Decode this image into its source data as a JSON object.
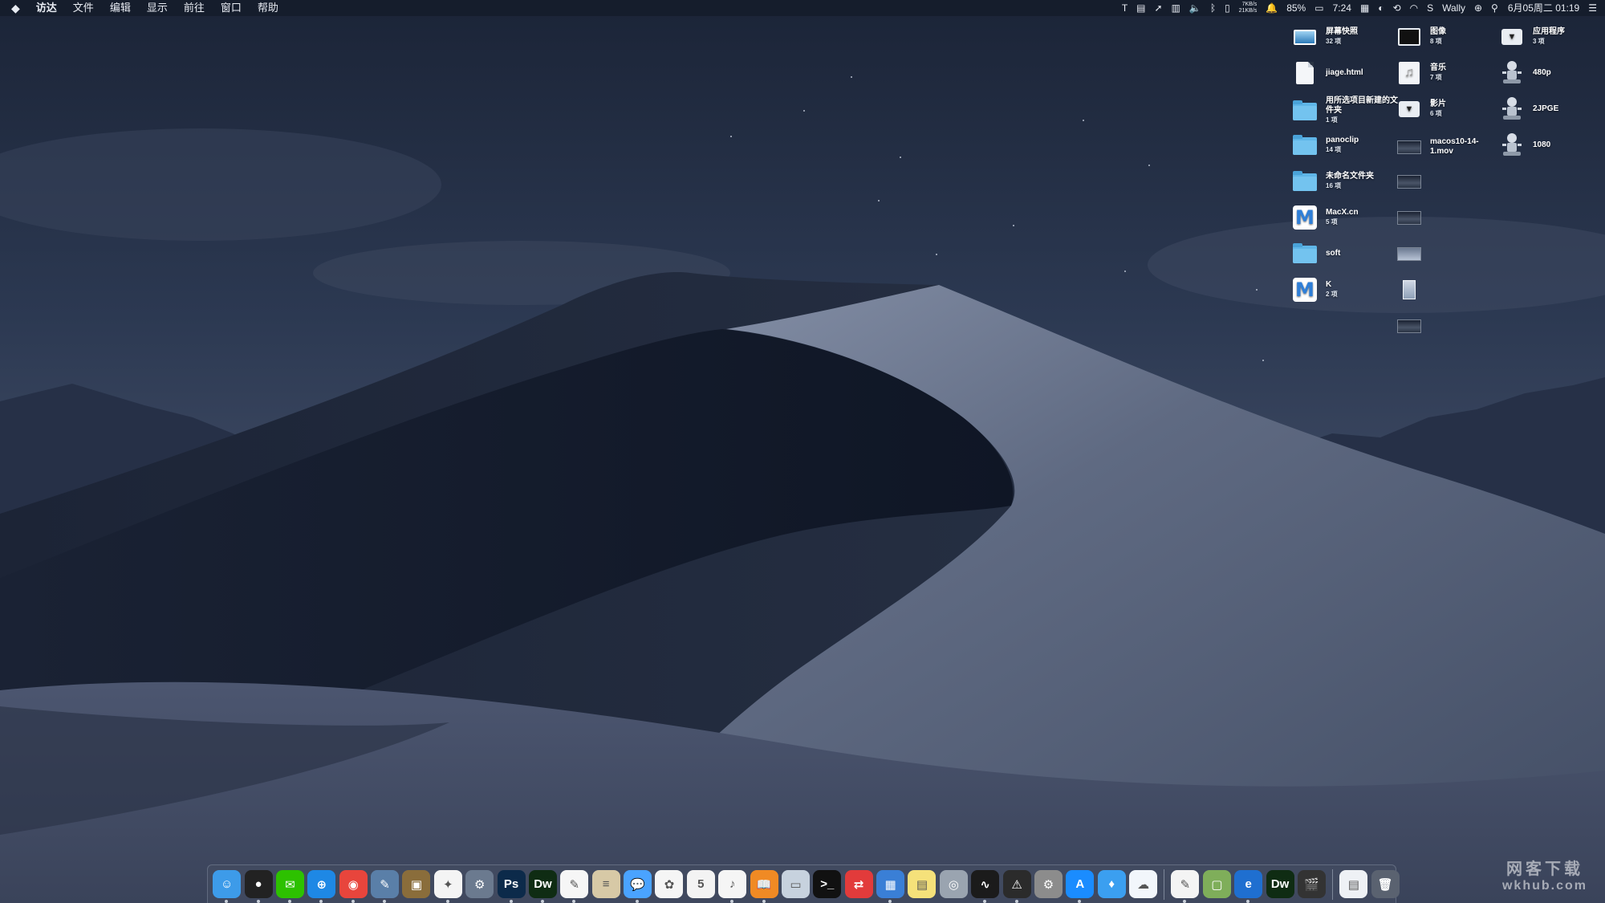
{
  "menubar": {
    "apple": "",
    "app_name": "访达",
    "menus": [
      "文件",
      "编辑",
      "显示",
      "前往",
      "窗口",
      "帮助"
    ],
    "status": {
      "net_up": "7KB/s",
      "net_down": "21KB/s",
      "battery": "85%",
      "time_small": "7:24",
      "user": "Wally",
      "datetime": "6月05周二 01:19"
    }
  },
  "desktop": {
    "items": [
      {
        "name": "屏幕快照",
        "count": "32 项",
        "icon": "screenshot-folder-icon"
      },
      {
        "name": "jiage.html",
        "count": "",
        "icon": "html-file-icon"
      },
      {
        "name": "用所选项目新建的文件夹",
        "count": "1 项",
        "icon": "folder-icon"
      },
      {
        "name": "panoclip",
        "count": "14 项",
        "icon": "folder-icon"
      },
      {
        "name": "未命名文件夹",
        "count": "16 项",
        "icon": "folder-icon"
      },
      {
        "name": "MacX.cn",
        "count": "5 项",
        "icon": "macx-m-icon"
      },
      {
        "name": "soft",
        "count": "",
        "icon": "folder-icon"
      },
      {
        "name": "K",
        "count": "2 项",
        "icon": "macx-m-icon"
      },
      {
        "name": "图像",
        "count": "8 项",
        "icon": "image-folder-icon"
      },
      {
        "name": "音乐",
        "count": "7 项",
        "icon": "music-file-icon"
      },
      {
        "name": "影片",
        "count": "6 项",
        "icon": "disk-image-icon"
      },
      {
        "name": "macos10-14-1.mov",
        "count": "",
        "icon": "video-thumbnail-icon"
      },
      {
        "name": "应用程序",
        "count": "3 项",
        "icon": "disk-image-icon"
      },
      {
        "name": "480p",
        "count": "",
        "icon": "automator-icon"
      },
      {
        "name": "2JPGE",
        "count": "",
        "icon": "automator-icon"
      },
      {
        "name": "1080",
        "count": "",
        "icon": "automator-icon"
      }
    ]
  },
  "dock": {
    "apps": [
      {
        "icon": "finder-icon",
        "color": "#3d9be9",
        "glyph": "☺"
      },
      {
        "icon": "qq-icon",
        "color": "#222222",
        "glyph": "●"
      },
      {
        "icon": "wechat-icon",
        "color": "#2dc100",
        "glyph": "✉"
      },
      {
        "icon": "safari-icon",
        "color": "#1e88e5",
        "glyph": "⊕"
      },
      {
        "icon": "chrome-icon",
        "color": "#e8453c",
        "glyph": "◉"
      },
      {
        "icon": "preview-editor-icon",
        "color": "#5a7fa8",
        "glyph": "✎"
      },
      {
        "icon": "archive-utility-icon",
        "color": "#8a6d3b",
        "glyph": "▣"
      },
      {
        "icon": "pinwheel-app-icon",
        "color": "#f4f4f4",
        "glyph": "✦"
      },
      {
        "icon": "automator-icon",
        "color": "#6b7a8f",
        "glyph": "⚙"
      },
      {
        "icon": "photoshop-icon",
        "color": "#0c2a4a",
        "glyph": "Ps"
      },
      {
        "icon": "dreamweaver-icon",
        "color": "#0f2c13",
        "glyph": "Dw"
      },
      {
        "icon": "textedit-icon",
        "color": "#f6f6f6",
        "glyph": "✎"
      },
      {
        "icon": "notes-pad-icon",
        "color": "#d7c9a6",
        "glyph": "≡"
      },
      {
        "icon": "messages-icon",
        "color": "#4aa3ff",
        "glyph": "💬"
      },
      {
        "icon": "photos-icon",
        "color": "#f5f5f5",
        "glyph": "✿"
      },
      {
        "icon": "calendar-icon",
        "color": "#f3f3f3",
        "glyph": "5"
      },
      {
        "icon": "itunes-icon",
        "color": "#f5f5f5",
        "glyph": "♪"
      },
      {
        "icon": "books-icon",
        "color": "#f08a24",
        "glyph": "📖"
      },
      {
        "icon": "image-capture-icon",
        "color": "#c7d2de",
        "glyph": "▭"
      },
      {
        "icon": "terminal-icon",
        "color": "#111111",
        "glyph": ">_"
      },
      {
        "icon": "screen-sharing-icon",
        "color": "#e23b3b",
        "glyph": "⇄"
      },
      {
        "icon": "remote-desktop-icon",
        "color": "#3a7fd6",
        "glyph": "▦"
      },
      {
        "icon": "stickies-icon",
        "color": "#f5e17a",
        "glyph": "▤"
      },
      {
        "icon": "disk-utility-icon",
        "color": "#9aa4b0",
        "glyph": "◎"
      },
      {
        "icon": "activity-monitor-icon",
        "color": "#1b1b1b",
        "glyph": "∿"
      },
      {
        "icon": "console-icon",
        "color": "#2b2b2b",
        "glyph": "⚠"
      },
      {
        "icon": "system-preferences-icon",
        "color": "#8c8c8c",
        "glyph": "⚙"
      },
      {
        "icon": "app-store-icon",
        "color": "#1a8cff",
        "glyph": "A"
      },
      {
        "icon": "tweetbot-icon",
        "color": "#3b9ff0",
        "glyph": "♦"
      },
      {
        "icon": "baidu-netdisk-icon",
        "color": "#f2f6fb",
        "glyph": "☁"
      }
    ],
    "docs": [
      {
        "icon": "pages-doc-icon",
        "color": "#f4f4f4",
        "glyph": "✎"
      },
      {
        "icon": "green-doc-icon",
        "color": "#7fae5a",
        "glyph": "▢"
      },
      {
        "icon": "edge-browser-icon",
        "color": "#1f6fd0",
        "glyph": "e"
      },
      {
        "icon": "dreamweaver-doc-icon",
        "color": "#0f2c13",
        "glyph": "Dw"
      },
      {
        "icon": "final-cut-icon",
        "color": "#333333",
        "glyph": "🎬"
      }
    ],
    "trash_area": [
      {
        "icon": "downloads-stack-icon",
        "color": "#eef1f5",
        "glyph": "▤"
      },
      {
        "icon": "trash-icon",
        "color": "#5a6270",
        "glyph": "🗑"
      }
    ]
  },
  "watermark": {
    "line1": "网客下载",
    "line2": "wkhub.com"
  }
}
